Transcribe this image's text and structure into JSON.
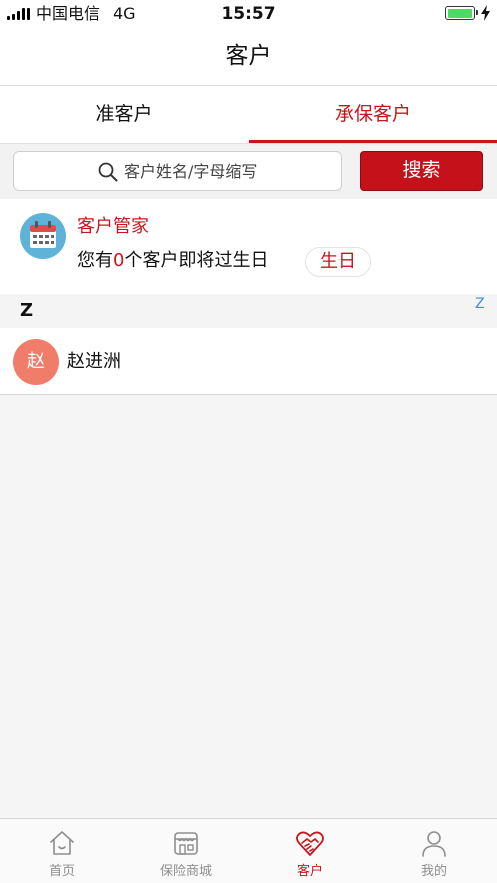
{
  "status_bar": {
    "carrier": "中国电信",
    "network": "4G",
    "time": "15:57",
    "battery_level": 1.0,
    "battery_color": "#4cd964",
    "charging_icon": "lightning-bolt-icon"
  },
  "nav": {
    "title": "客户"
  },
  "tabs": [
    {
      "label": "准客户",
      "active": false
    },
    {
      "label": "承保客户",
      "active": true
    }
  ],
  "search": {
    "placeholder": "客户姓名/字母缩写",
    "button_label": "搜索",
    "icon": "search-icon"
  },
  "manager": {
    "icon": "calendar-icon",
    "title": "客户管家",
    "birthday_prefix": "您有",
    "birthday_count": "0",
    "birthday_suffix": "个客户即将过生日",
    "birthday_button": "生日"
  },
  "section": {
    "letter": "Z",
    "index_letter": "Z"
  },
  "customers": [
    {
      "avatar": "赵",
      "name": "赵进洲"
    }
  ],
  "bottom_tabs": [
    {
      "label": "首页",
      "icon": "home-icon",
      "active": false
    },
    {
      "label": "保险商城",
      "icon": "store-icon",
      "active": false
    },
    {
      "label": "客户",
      "icon": "handshake-heart-icon",
      "active": true
    },
    {
      "label": "我的",
      "icon": "person-icon",
      "active": false
    }
  ],
  "colors": {
    "accent": "#c7161e",
    "search_button": "#c4111a",
    "avatar": "#f07c6a",
    "index_letter": "#3a8ee6",
    "inactive_tab": "#8e8e8e"
  }
}
